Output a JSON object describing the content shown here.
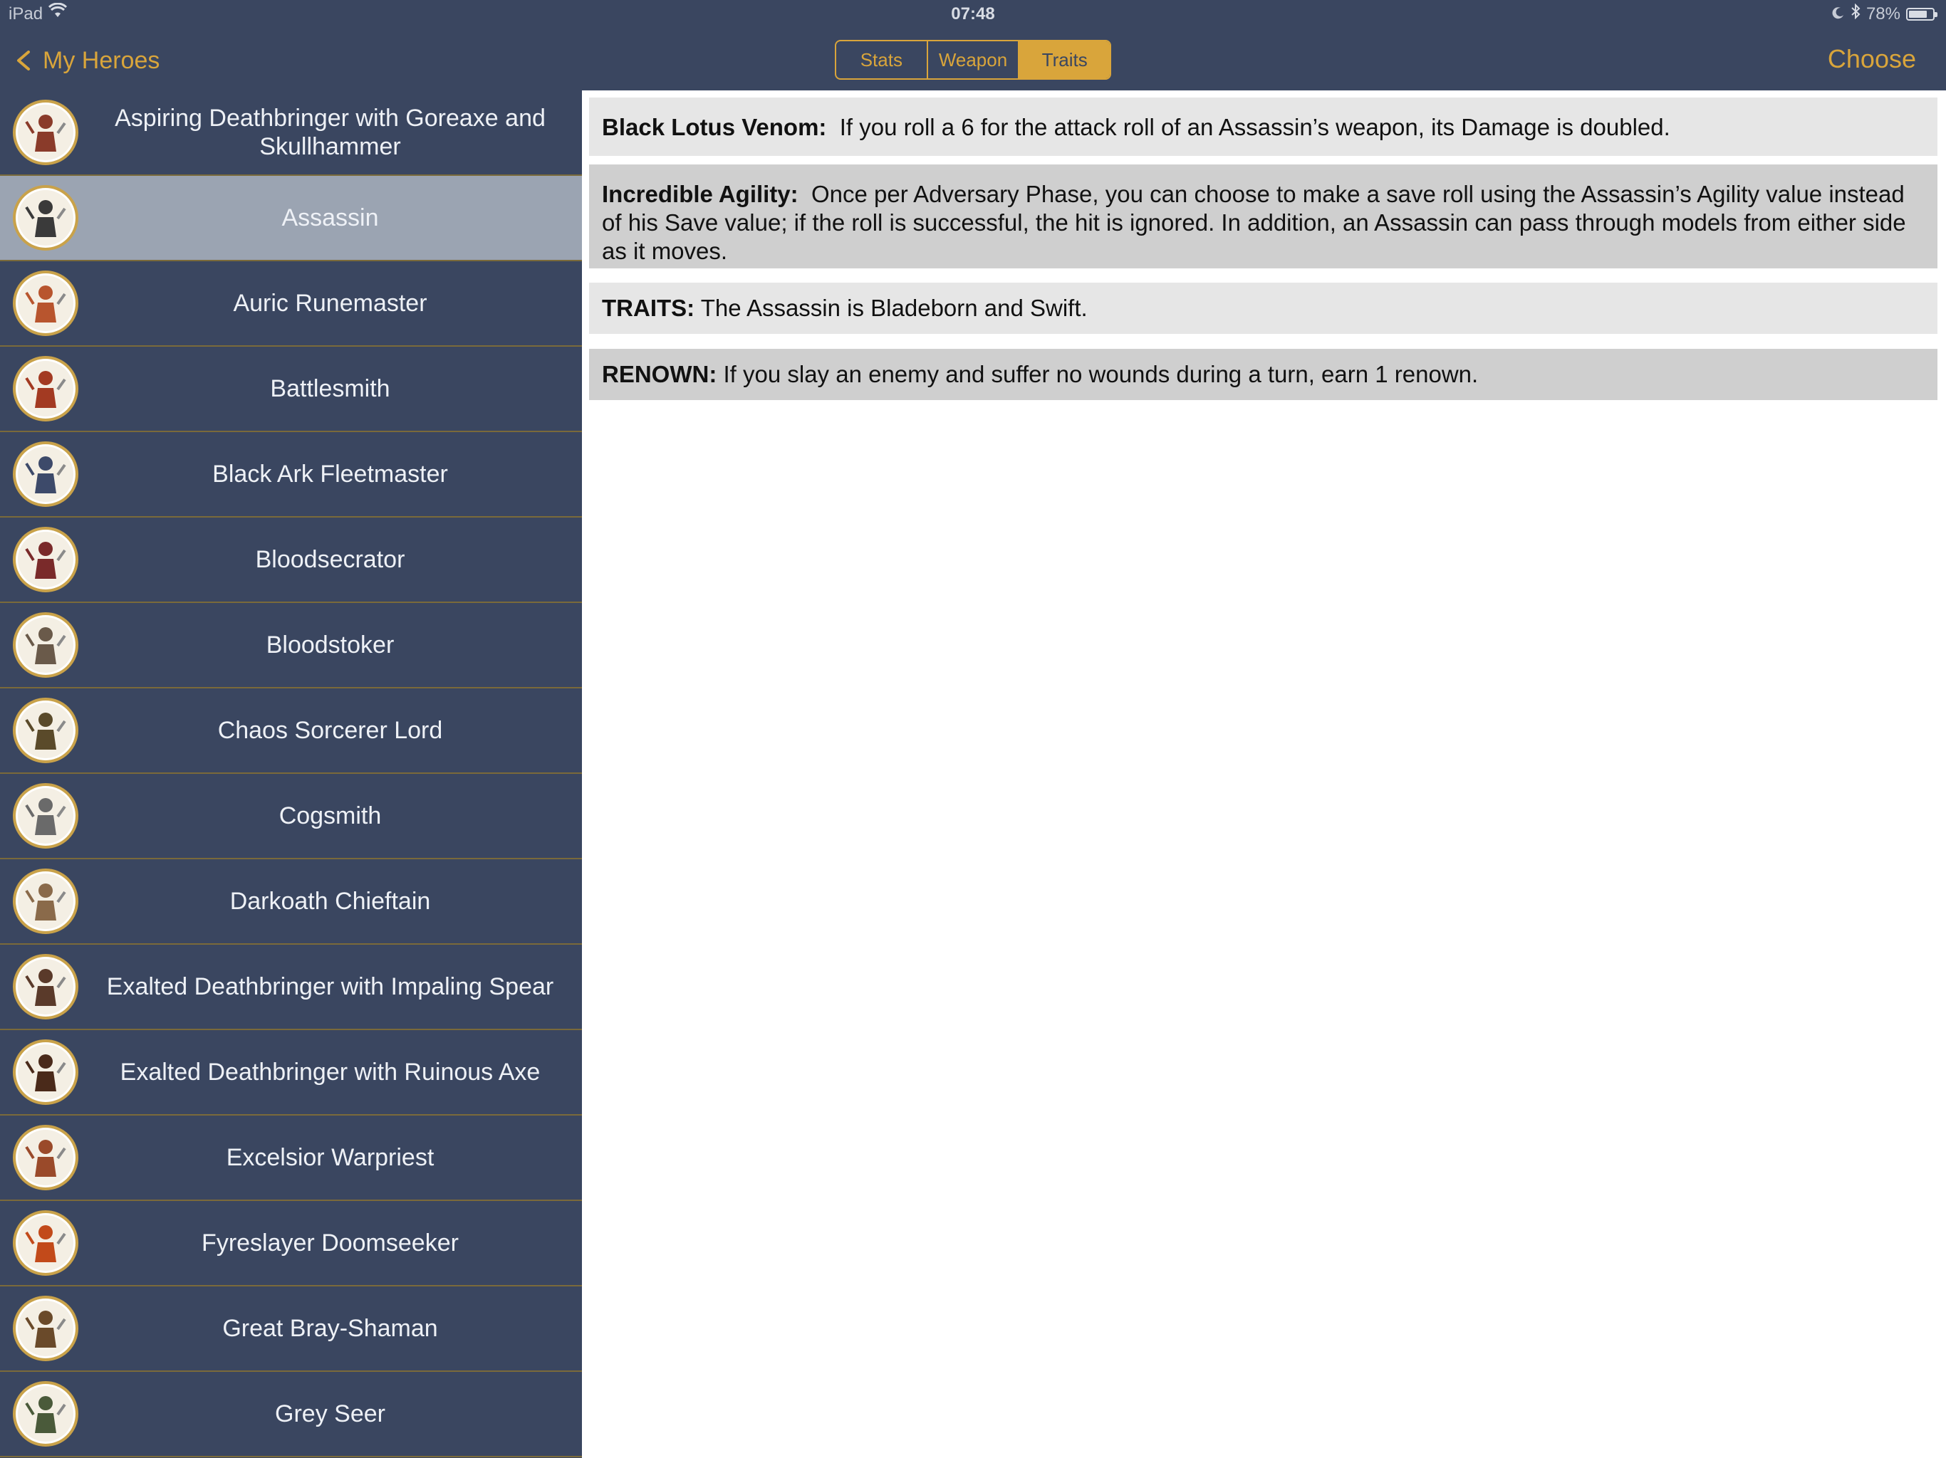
{
  "status_bar": {
    "device": "iPad",
    "time": "07:48",
    "battery_percent": "78%",
    "battery_level": 0.78
  },
  "nav": {
    "back_label": "My Heroes",
    "tabs": [
      {
        "label": "Stats",
        "active": false
      },
      {
        "label": "Weapon",
        "active": false
      },
      {
        "label": "Traits",
        "active": true
      }
    ],
    "choose_label": "Choose"
  },
  "colors": {
    "nav_background": "#3a4660",
    "accent_gold": "#d9a53b",
    "selected_row": "#9ba4b2",
    "row_divider": "#7a6a3a"
  },
  "heroes": [
    {
      "name": "Aspiring Deathbringer with Goreaxe and Skullhammer",
      "selected": false
    },
    {
      "name": "Assassin",
      "selected": true
    },
    {
      "name": "Auric Runemaster",
      "selected": false
    },
    {
      "name": "Battlesmith",
      "selected": false
    },
    {
      "name": "Black Ark Fleetmaster",
      "selected": false
    },
    {
      "name": "Bloodsecrator",
      "selected": false
    },
    {
      "name": "Bloodstoker",
      "selected": false
    },
    {
      "name": "Chaos Sorcerer Lord",
      "selected": false
    },
    {
      "name": "Cogsmith",
      "selected": false
    },
    {
      "name": "Darkoath Chieftain",
      "selected": false
    },
    {
      "name": "Exalted Deathbringer with Impaling Spear",
      "selected": false
    },
    {
      "name": "Exalted Deathbringer with Ruinous Axe",
      "selected": false
    },
    {
      "name": "Excelsior Warpriest",
      "selected": false
    },
    {
      "name": "Fyreslayer Doomseeker",
      "selected": false
    },
    {
      "name": "Great Bray-Shaman",
      "selected": false
    },
    {
      "name": "Grey Seer",
      "selected": false
    }
  ],
  "traits": [
    {
      "title": "Black Lotus Venom:",
      "text": "If you roll a 6 for the attack roll of an Assassin’s weapon, its Damage is doubled."
    },
    {
      "title": "Incredible Agility:",
      "text": "Once per Adversary Phase, you can choose to make a save roll using the Assassin’s Agility value instead of his Save value; if the roll is successful, the hit is ignored. In addition, an Assassin can pass through models from either side as it moves."
    },
    {
      "title": "TRAITS:",
      "text": "The Assassin is Bladeborn and Swift."
    },
    {
      "title": "RENOWN:",
      "text": "If you slay an enemy and suffer no wounds during a turn, earn 1 renown."
    }
  ]
}
